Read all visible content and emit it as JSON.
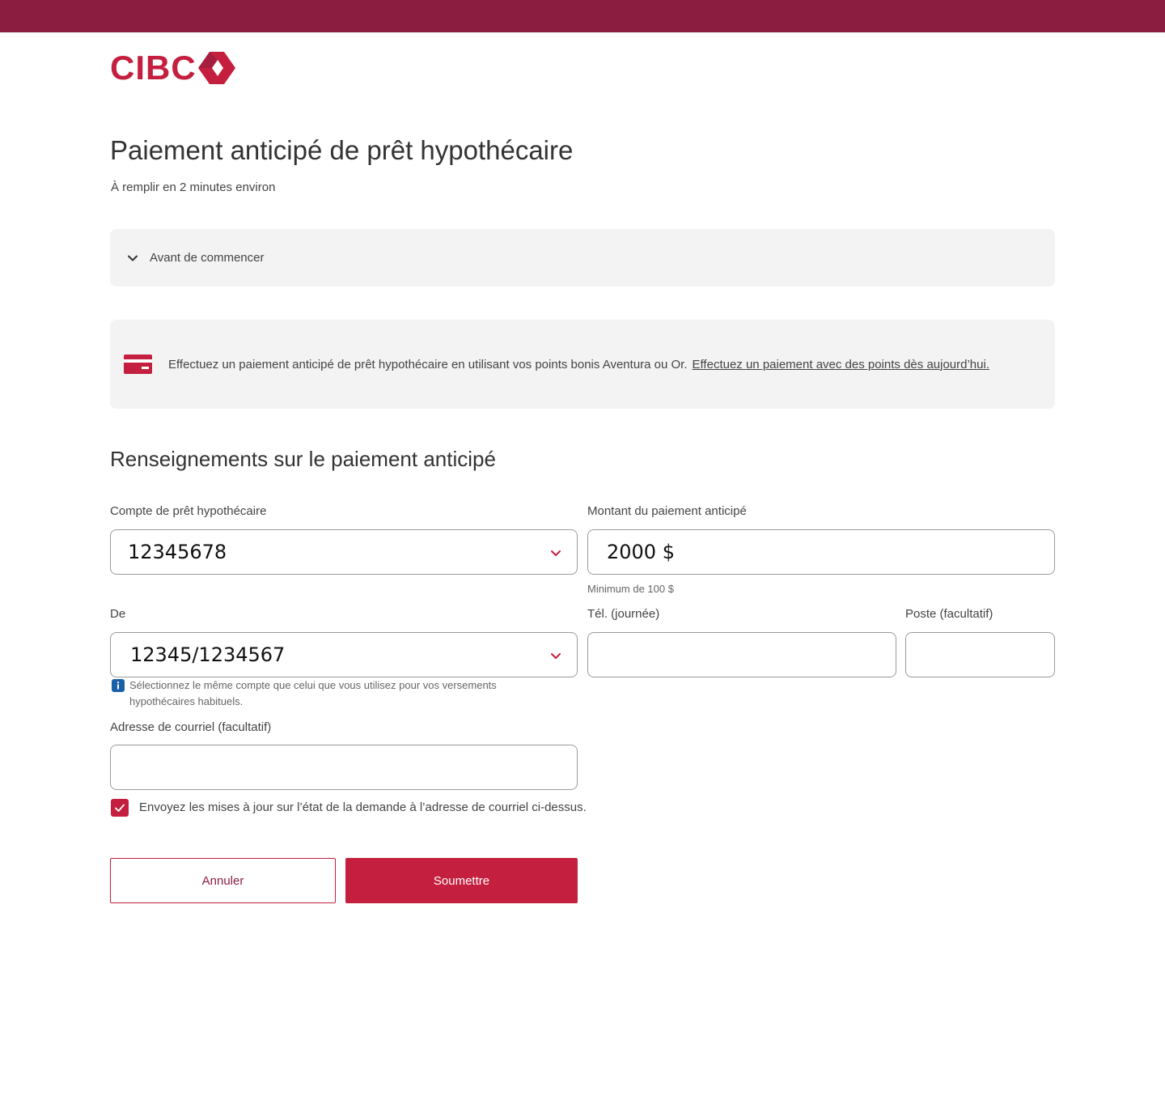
{
  "brand": {
    "logo_text": "CIBC",
    "logo_icon": "cibc-diamond-icon",
    "topbar_color": "#8b1d41",
    "accent_color": "#c41f3e"
  },
  "page": {
    "title": "Paiement anticipé de prêt hypothécaire",
    "subtitle": "À remplir en 2 minutes environ"
  },
  "accordion": {
    "icon": "chevron-down-icon",
    "label": "Avant de commencer"
  },
  "promo": {
    "icon": "credit-card-icon",
    "text": "Effectuez un paiement anticipé de prêt hypothécaire en utilisant vos points bonis Aventura ou Or.",
    "link": "Effectuez un paiement avec des points dès aujourd’hui."
  },
  "section": {
    "title": "Renseignements sur le paiement anticipé"
  },
  "form": {
    "mortgage_account": {
      "label": "Compte de prêt hypothécaire",
      "value": "12345678"
    },
    "prepayment_amount": {
      "label": "Montant du paiement anticipé",
      "value": "2000 $",
      "hint": "Minimum de 100 $"
    },
    "from_account": {
      "label": "De",
      "value": "12345/1234567",
      "hint_line1": "Sélectionnez le même compte que celui que vous utilisez pour vos versements",
      "hint_line2": "hypothécaires habituels."
    },
    "phone": {
      "label": "Tél. (journée)",
      "value": ""
    },
    "extension": {
      "label": "Poste (facultatif)",
      "value": ""
    },
    "email": {
      "label": "Adresse de courriel (facultatif)",
      "value": ""
    },
    "email_updates": {
      "label": "Envoyez les mises à jour sur l’état de la demande à l’adresse de courriel ci-dessus.",
      "checked": true
    }
  },
  "buttons": {
    "cancel": "Annuler",
    "submit": "Soumettre"
  }
}
